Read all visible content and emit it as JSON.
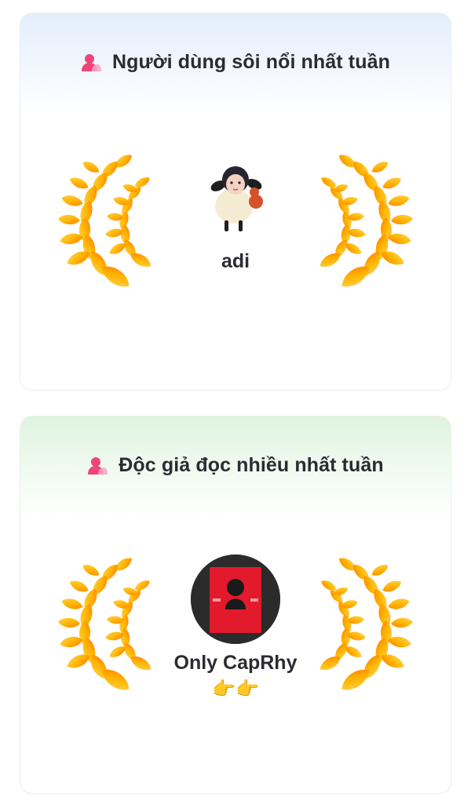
{
  "cards": [
    {
      "title": "Người dùng sôi nổi nhất tuần",
      "icon": "user-icon",
      "user": {
        "name": "adi",
        "avatar": "sheep-doll-photo"
      }
    },
    {
      "title": "Độc giả đọc nhiều nhất tuần",
      "icon": "user-icon",
      "user": {
        "name": "Only CapRhy",
        "extra": "👉👉",
        "avatar": "red-book-cover-photo"
      }
    }
  ],
  "colors": {
    "title": "#2b2b33",
    "icon_pink": "#f0457a",
    "laurel_gold": "#ffb300",
    "laurel_orange": "#ff7a00",
    "card1_header_tint": "#e3edfb",
    "card2_header_tint": "#dff4df"
  }
}
